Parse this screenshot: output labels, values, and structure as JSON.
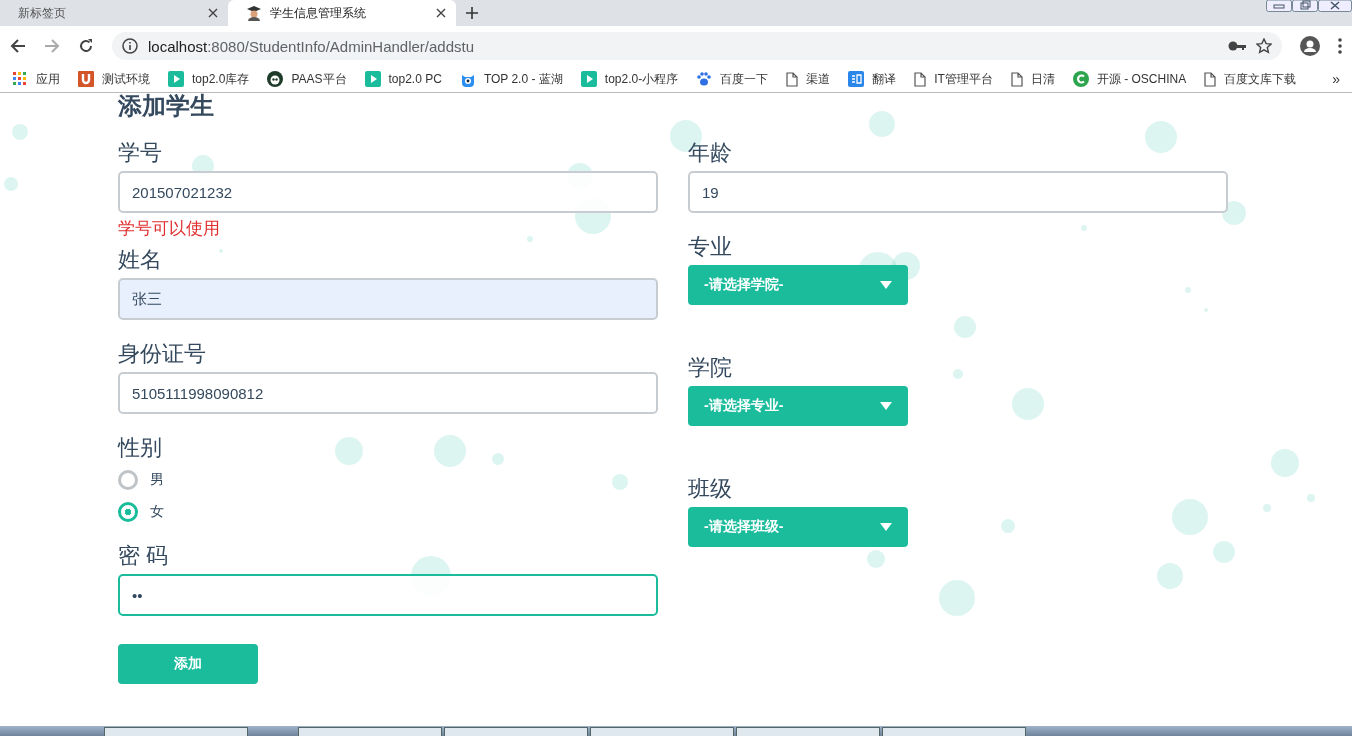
{
  "browser": {
    "tabs": [
      {
        "title": "新标签页",
        "selected": false
      },
      {
        "title": "学生信息管理系统",
        "selected": true
      }
    ],
    "address": {
      "host": "localhost",
      "path": ":8080/StudentInfo/AdminHandler/addstu"
    },
    "bookmarks": [
      {
        "label": "应用"
      },
      {
        "label": "测试环境"
      },
      {
        "label": "top2.0库存"
      },
      {
        "label": "PAAS平台"
      },
      {
        "label": "top2.0 PC"
      },
      {
        "label": "TOP 2.0 - 蓝湖"
      },
      {
        "label": "top2.0-小程序"
      },
      {
        "label": "百度一下"
      },
      {
        "label": "渠道"
      },
      {
        "label": "翻译"
      },
      {
        "label": "IT管理平台"
      },
      {
        "label": "日清"
      },
      {
        "label": "开源 - OSCHINA"
      },
      {
        "label": "百度文库下载"
      }
    ],
    "more": "»"
  },
  "form": {
    "title": "添加学生",
    "left": [
      {
        "kind": "text",
        "label": "学号",
        "value": "201507021232",
        "message": "学号可以使用",
        "autofilled": false,
        "focused": false
      },
      {
        "kind": "text",
        "label": "姓名",
        "value": "张三",
        "autofilled": true,
        "focused": false
      },
      {
        "kind": "text",
        "label": "身份证号",
        "value": "5105111998090812",
        "autofilled": false,
        "focused": false
      },
      {
        "kind": "radio",
        "label": "性别",
        "options": [
          {
            "label": "男",
            "selected": false
          },
          {
            "label": "女",
            "selected": true
          }
        ]
      },
      {
        "kind": "text",
        "label": "密 码",
        "value": "••",
        "autofilled": false,
        "focused": true
      }
    ],
    "right": [
      {
        "kind": "text",
        "label": "年龄",
        "value": "19",
        "autofilled": false,
        "focused": false
      },
      {
        "kind": "select",
        "label": "专业",
        "placeholder": "-请选择学院-"
      },
      {
        "kind": "select",
        "label": "学院",
        "placeholder": "-请选择专业-"
      },
      {
        "kind": "select",
        "label": "班级",
        "placeholder": "-请选择班级-"
      }
    ],
    "submit": "添加"
  }
}
